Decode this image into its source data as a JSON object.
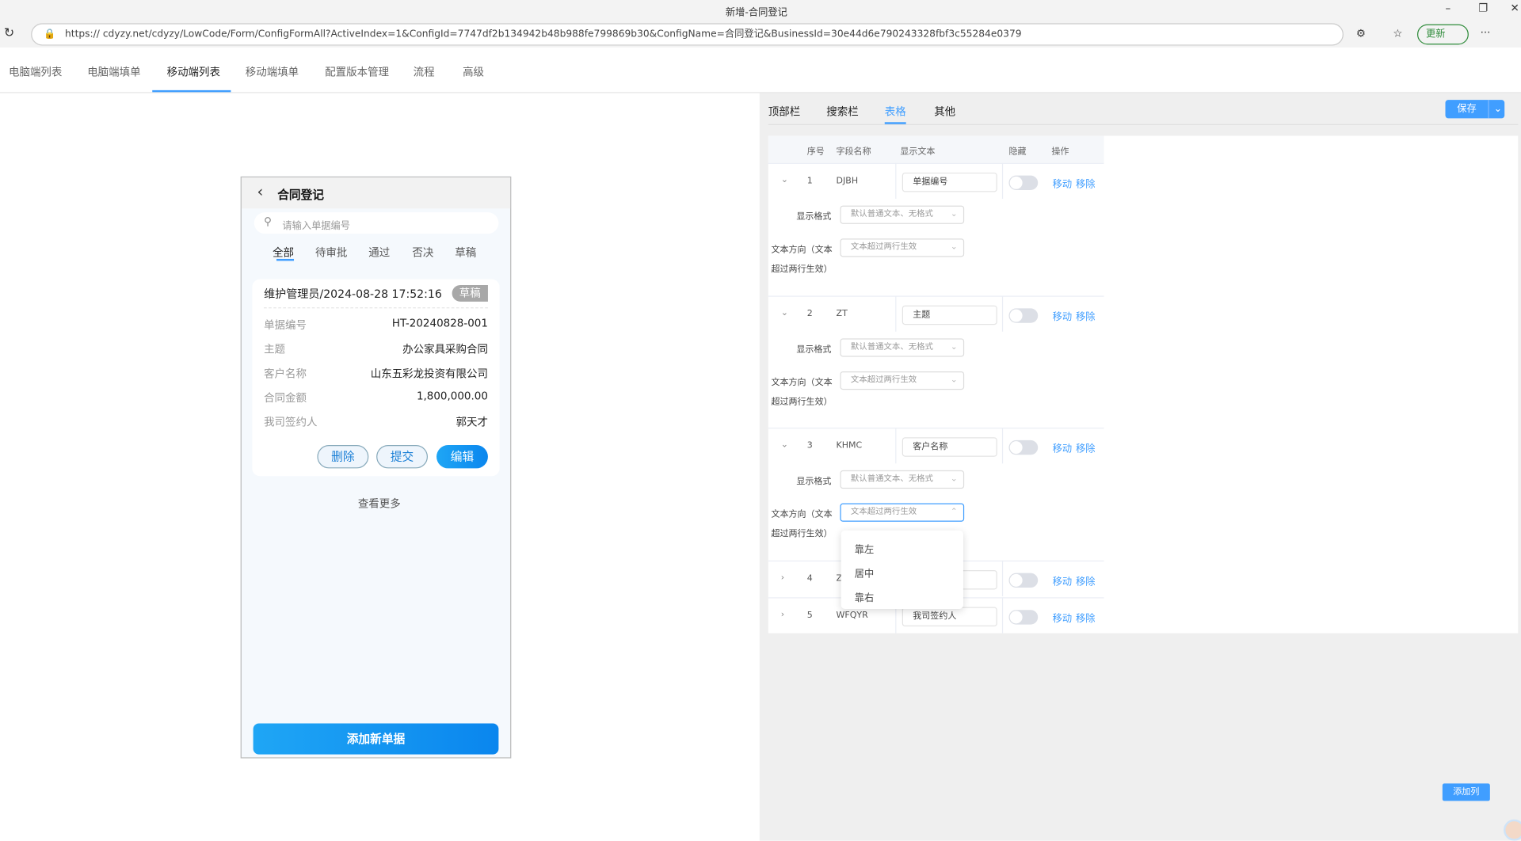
{
  "browser": {
    "title": "新增-合同登记",
    "url": "https://   cdyzy.net/cdyzy/LowCode/Form/ConfigFormAll?ActiveIndex=1&ConfigId=7747df2b134942b48b988fe799869b30&ConfigName=合同登记&BusinessId=30e44d6e790243328fbf3c55284e0379",
    "update_label": "更新"
  },
  "top_tabs": [
    "电脑端列表",
    "电脑端填单",
    "移动端列表",
    "移动端填单",
    "配置版本管理",
    "流程",
    "高级"
  ],
  "phone": {
    "title": "合同登记",
    "search_placeholder": "请输入单据编号",
    "tabs": [
      "全部",
      "待审批",
      "通过",
      "否决",
      "草稿"
    ],
    "card": {
      "header": "维护管理员/2024-08-28 17:52:16",
      "status": "草稿",
      "fields": [
        {
          "k": "单据编号",
          "v": "HT-20240828-001"
        },
        {
          "k": "主题",
          "v": "办公家具采购合同"
        },
        {
          "k": "客户名称",
          "v": "山东五彩龙投资有限公司"
        },
        {
          "k": "合同金额",
          "v": "1,800,000.00"
        },
        {
          "k": "我司签约人",
          "v": "郭天才"
        }
      ],
      "buttons": {
        "delete": "删除",
        "submit": "提交",
        "edit": "编辑"
      }
    },
    "more": "查看更多",
    "add": "添加新单据"
  },
  "config": {
    "tabs": [
      "顶部栏",
      "搜索栏",
      "表格",
      "其他"
    ],
    "save": "保存",
    "add_column": "添加列",
    "headers": {
      "index": "序号",
      "field": "字段名称",
      "text": "显示文本",
      "hidden": "隐藏",
      "ops": "操作"
    },
    "labels": {
      "format": "显示格式",
      "direction_1": "文本方向（文本",
      "direction_2": "超过两行生效）",
      "move": "移动",
      "remove": "移除"
    },
    "rows": [
      {
        "index": "1",
        "field": "DJBH",
        "text": "单据编号",
        "expanded": true,
        "format": "默认普通文本、无格式",
        "direction": "文本超过两行生效"
      },
      {
        "index": "2",
        "field": "ZT",
        "text": "主题",
        "expanded": true,
        "format": "默认普通文本、无格式",
        "direction": "文本超过两行生效"
      },
      {
        "index": "3",
        "field": "KHMC",
        "text": "客户名称",
        "expanded": true,
        "format": "默认普通文本、无格式",
        "direction": "文本超过两行生效"
      },
      {
        "index": "4",
        "field": "Z",
        "text": "",
        "expanded": false
      },
      {
        "index": "5",
        "field": "WFQYR",
        "text": "我司签约人",
        "expanded": false
      }
    ],
    "dropdown": [
      "靠左",
      "居中",
      "靠右"
    ]
  }
}
